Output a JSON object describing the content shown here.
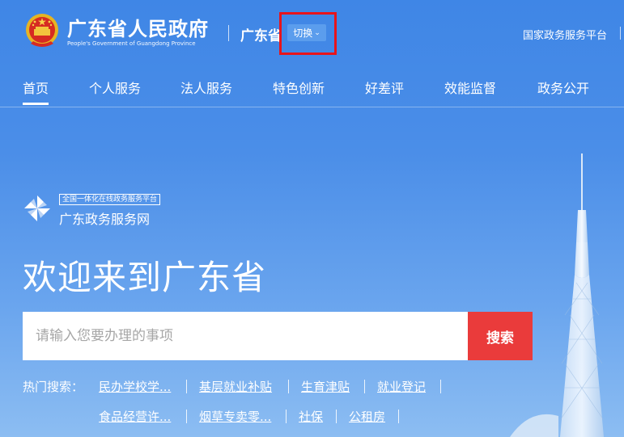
{
  "header": {
    "emblem_icon": "national-emblem-icon",
    "title": "广东省人民政府",
    "subtitle": "People's Government of Guangdong Province",
    "region": "广东省",
    "switch_label": "切换",
    "switch_icon": "chevron-down-icon",
    "national_link": "国家政务服务平台"
  },
  "nav": {
    "items": [
      "首页",
      "个人服务",
      "法人服务",
      "特色创新",
      "好差评",
      "效能监督",
      "政务公开"
    ],
    "active_index": 0
  },
  "platform": {
    "logo_icon": "pinwheel-logo-icon",
    "badge": "全国一体化在线政务服务平台",
    "name": "广东政务服务网"
  },
  "welcome": "欢迎来到广东省",
  "search": {
    "placeholder": "请输入您要办理的事项",
    "value": "",
    "button": "搜索"
  },
  "hot_search": {
    "label": "热门搜索：",
    "row1": [
      "民办学校学...",
      "基层就业补贴",
      "生育津贴",
      "就业登记"
    ],
    "row2": [
      "食品经营许...",
      "烟草专卖零...",
      "社保",
      "公租房"
    ]
  },
  "colors": {
    "background": "#4b8ee8",
    "search_button": "#ea3b3b",
    "highlight_box": "#e8141b",
    "switch_button": "#5b9ded"
  }
}
